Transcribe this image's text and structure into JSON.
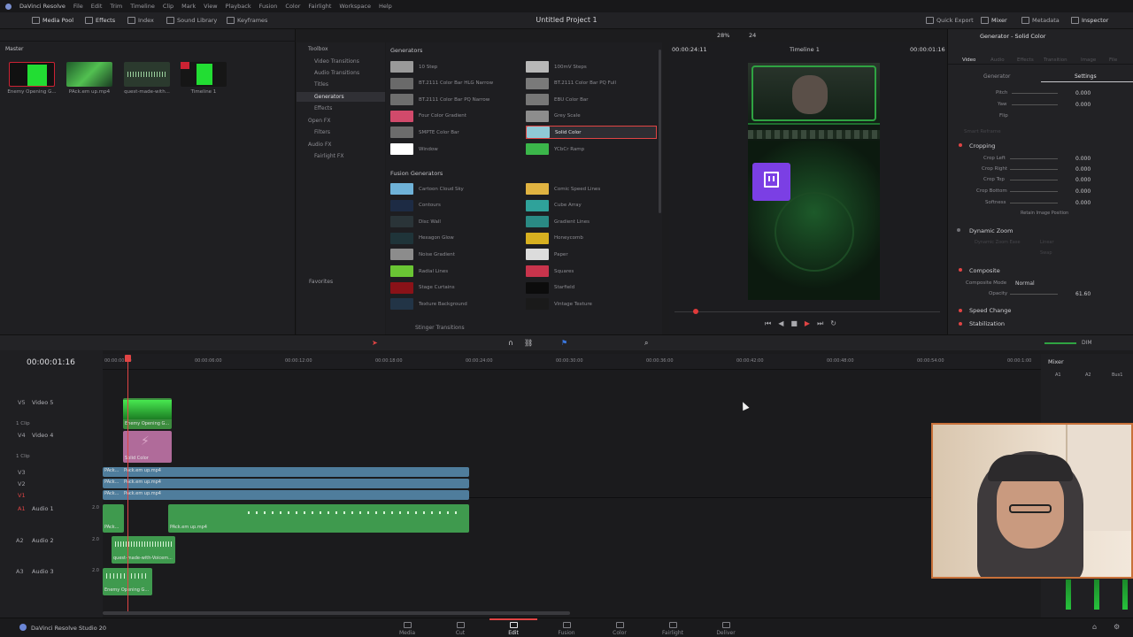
{
  "menubar": {
    "app_name": "DaVinci Resolve",
    "items": [
      "File",
      "Edit",
      "Trim",
      "Timeline",
      "Clip",
      "Mark",
      "View",
      "Playback",
      "Fusion",
      "Color",
      "Fairlight",
      "Workspace",
      "Help"
    ]
  },
  "toolbar": {
    "media_pool": "Media Pool",
    "effects": "Effects",
    "index": "Index",
    "sound_library": "Sound Library",
    "keyframes": "Keyframes",
    "project_title": "Untitled Project 1",
    "quick_export": "Quick Export",
    "mixer": "Mixer",
    "metadata": "Metadata",
    "inspector": "Inspector"
  },
  "mediapool": {
    "bin": "Master",
    "clips": [
      {
        "label": "Enemy Opening G..."
      },
      {
        "label": "PAck.em up.mp4"
      },
      {
        "label": "quest-made-with..."
      },
      {
        "label": "Timeline 1"
      }
    ]
  },
  "toolbox": {
    "items": [
      "Toolbox",
      "Video Transitions",
      "Audio Transitions",
      "Titles",
      "Generators",
      "Effects",
      "Open FX",
      "Filters",
      "Audio FX",
      "Fairlight FX"
    ],
    "favorites": "Favorites"
  },
  "generators": {
    "header": "Generators",
    "items": [
      {
        "label": "10 Step",
        "color": "#9a9a9a"
      },
      {
        "label": "100mV Steps",
        "color": "#b8b8b8"
      },
      {
        "label": "BT.2111 Color Bar HLG Narrow",
        "color": "#6a6a6a"
      },
      {
        "label": "BT.2111 Color Bar PQ Full",
        "color": "#7a7a7a"
      },
      {
        "label": "BT.2111 Color Bar PQ Narrow",
        "color": "#6e6e6e"
      },
      {
        "label": "EBU Color Bar",
        "color": "#777777"
      },
      {
        "label": "Four Color Gradient",
        "color": "#d14a6b"
      },
      {
        "label": "Grey Scale",
        "color": "#8d8d8d"
      },
      {
        "label": "SMPTE Color Bar",
        "color": "#6c6c6c"
      },
      {
        "label": "Solid Color",
        "color": "#8fc9d6"
      },
      {
        "label": "Window",
        "color": "#ffffff"
      },
      {
        "label": "YCbCr Ramp",
        "color": "#3bb64a"
      }
    ],
    "fusion_header": "Fusion Generators",
    "fusion_items": [
      {
        "label": "Cartoon Cloud Sky",
        "color": "#6fb2d8"
      },
      {
        "label": "Comic Speed Lines",
        "color": "#e0b341"
      },
      {
        "label": "Contours",
        "color": "#1d2b44"
      },
      {
        "label": "Cube Array",
        "color": "#2fa29a"
      },
      {
        "label": "Disc Wall",
        "color": "#2a3438"
      },
      {
        "label": "Gradient Lines",
        "color": "#2a8a84"
      },
      {
        "label": "Hexagon Glow",
        "color": "#1f3439"
      },
      {
        "label": "Honeycomb",
        "color": "#d7b020"
      },
      {
        "label": "Noise Gradient",
        "color": "#8c8c8c"
      },
      {
        "label": "Paper",
        "color": "#dcdcdc"
      },
      {
        "label": "Radial Lines",
        "color": "#6ac534"
      },
      {
        "label": "Squares",
        "color": "#c8344c"
      },
      {
        "label": "Stage Curtains",
        "color": "#8a1218"
      },
      {
        "label": "Starfield",
        "color": "#0c0c0c"
      },
      {
        "label": "Texture Background",
        "color": "#223446"
      },
      {
        "label": "Vintage Texture",
        "color": "#1a1a1a"
      }
    ],
    "stinger": "Stinger Transitions"
  },
  "viewer": {
    "zoom": "28%",
    "fps": "24",
    "timecode_left": "00:00:24:11",
    "timeline_name": "Timeline 1",
    "timecode_right": "00:00:01:16"
  },
  "inspector": {
    "title": "Generator - Solid Color",
    "tabs": [
      "Video",
      "Audio",
      "Effects",
      "Transition",
      "Image",
      "File"
    ],
    "subtabs": [
      "Generator",
      "Settings"
    ],
    "rows": [
      {
        "label": "Pitch",
        "value": "0.000"
      },
      {
        "label": "Yaw",
        "value": "0.000"
      },
      {
        "label": "Flip",
        "value": ""
      }
    ],
    "smart_reframe": "Smart Reframe",
    "cropping": {
      "title": "Cropping",
      "rows": [
        {
          "label": "Crop Left",
          "value": "0.000"
        },
        {
          "label": "Crop Right",
          "value": "0.000"
        },
        {
          "label": "Crop Top",
          "value": "0.000"
        },
        {
          "label": "Crop Bottom",
          "value": "0.000"
        },
        {
          "label": "Softness",
          "value": "0.000"
        }
      ],
      "retain": "Retain Image Position"
    },
    "dynamic_zoom": "Dynamic Zoom",
    "dz_ease": "Dynamic Zoom Ease",
    "dz_ease_val": "Linear",
    "dz_swap": "Swap",
    "composite": {
      "title": "Composite",
      "mode_label": "Composite Mode",
      "mode_value": "Normal",
      "opacity_label": "Opacity",
      "opacity_value": "61.60"
    },
    "speed_change": "Speed Change",
    "stabilization": "Stabilization"
  },
  "timeline": {
    "timecode": "00:00:01:16",
    "ruler": [
      "00:00:00:00",
      "00:00:06:00",
      "00:00:12:00",
      "00:00:18:00",
      "00:00:24:00",
      "00:00:30:00",
      "00:00:36:00",
      "00:00:42:00",
      "00:00:48:00",
      "00:00:54:00",
      "00:00:1:00"
    ],
    "tracks": {
      "v5": {
        "id": "V5",
        "name": "Video 5",
        "count": "1 Clip"
      },
      "v4": {
        "id": "V4",
        "name": "Video 4",
        "count": "1 Clip"
      },
      "v3": {
        "id": "V3"
      },
      "v2": {
        "id": "V2"
      },
      "v1": {
        "id": "V1"
      },
      "a1": {
        "id": "A1",
        "name": "Audio 1",
        "level": "2.0"
      },
      "a2": {
        "id": "A2",
        "name": "Audio 2",
        "level": "2.0"
      },
      "a3": {
        "id": "A3",
        "name": "Audio 3",
        "level": "2.0"
      }
    },
    "clips": {
      "v5": "Enemy Opening G...",
      "v4": "Solid Color",
      "v3": "PAck.em up.mp4",
      "v2": "PAck.em up.mp4",
      "v1": "PAck.em up.mp4",
      "a1": "PAck.em up.mp4",
      "a1b": "PAck.em up.mp4",
      "a2": "quest-made-with-Voicem...",
      "a3": "Enemy Opening G..."
    },
    "v_stub": "PAck..."
  },
  "mixer": {
    "title": "Mixer",
    "channels": [
      "A1",
      "A2",
      "Bus1"
    ],
    "dim": "DIM"
  },
  "bottombar": {
    "brand": "DaVinci Resolve Studio 20",
    "pages": [
      "Media",
      "Cut",
      "Edit",
      "Fusion",
      "Color",
      "Fairlight",
      "Deliver"
    ]
  }
}
